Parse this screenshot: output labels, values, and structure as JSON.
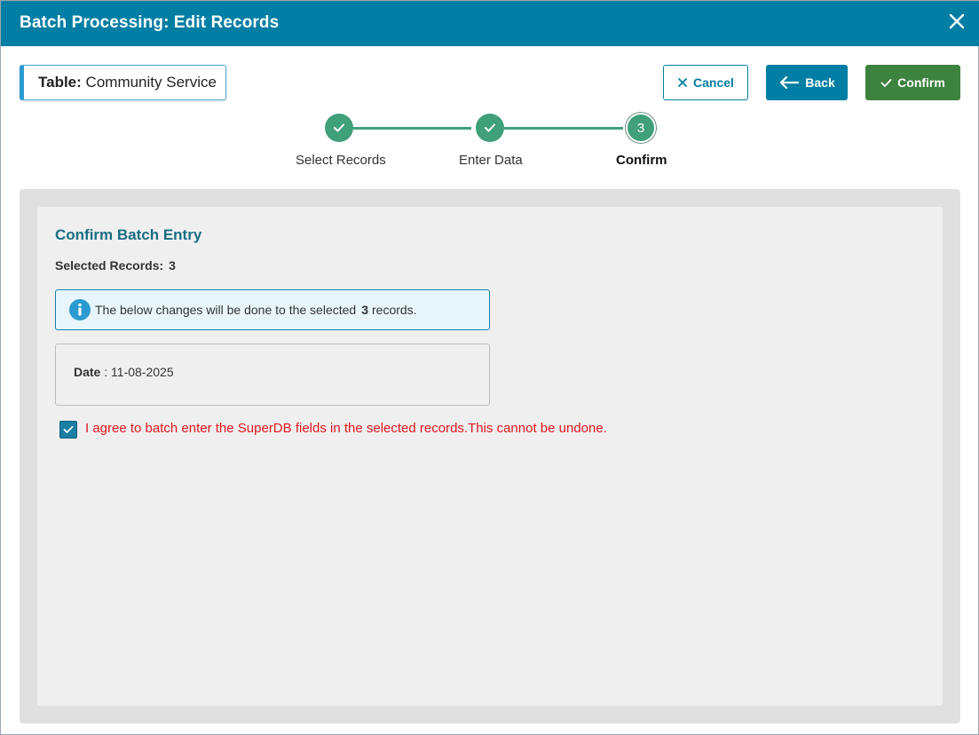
{
  "modal": {
    "title": "Batch Processing: Edit Records",
    "close_icon": "close-icon"
  },
  "table_chip": {
    "label": "Table:",
    "value": "Community Service"
  },
  "toolbar": {
    "cancel_label": "Cancel",
    "back_label": "Back",
    "confirm_label": "Confirm"
  },
  "stepper": {
    "steps": [
      {
        "label": "Select Records",
        "state": "done"
      },
      {
        "label": "Enter Data",
        "state": "done"
      },
      {
        "label": "Confirm",
        "state": "current",
        "number": "3"
      }
    ]
  },
  "confirm_section": {
    "title": "Confirm Batch Entry",
    "selected_label": "Selected Records:",
    "selected_count": "3",
    "info_prefix": "The below changes will be done to the selected",
    "info_count": "3",
    "info_suffix": "records.",
    "field_name": "Date",
    "field_sep": ":",
    "field_value": "11-08-2025",
    "agree_text": "I agree to batch enter the SuperDB fields in the selected records.This cannot be undone.",
    "agree_checked": true
  },
  "colors": {
    "header": "#007ea3",
    "confirm_green": "#3d8340",
    "step_green": "#3fa07a",
    "warning_red": "#e0191f"
  }
}
